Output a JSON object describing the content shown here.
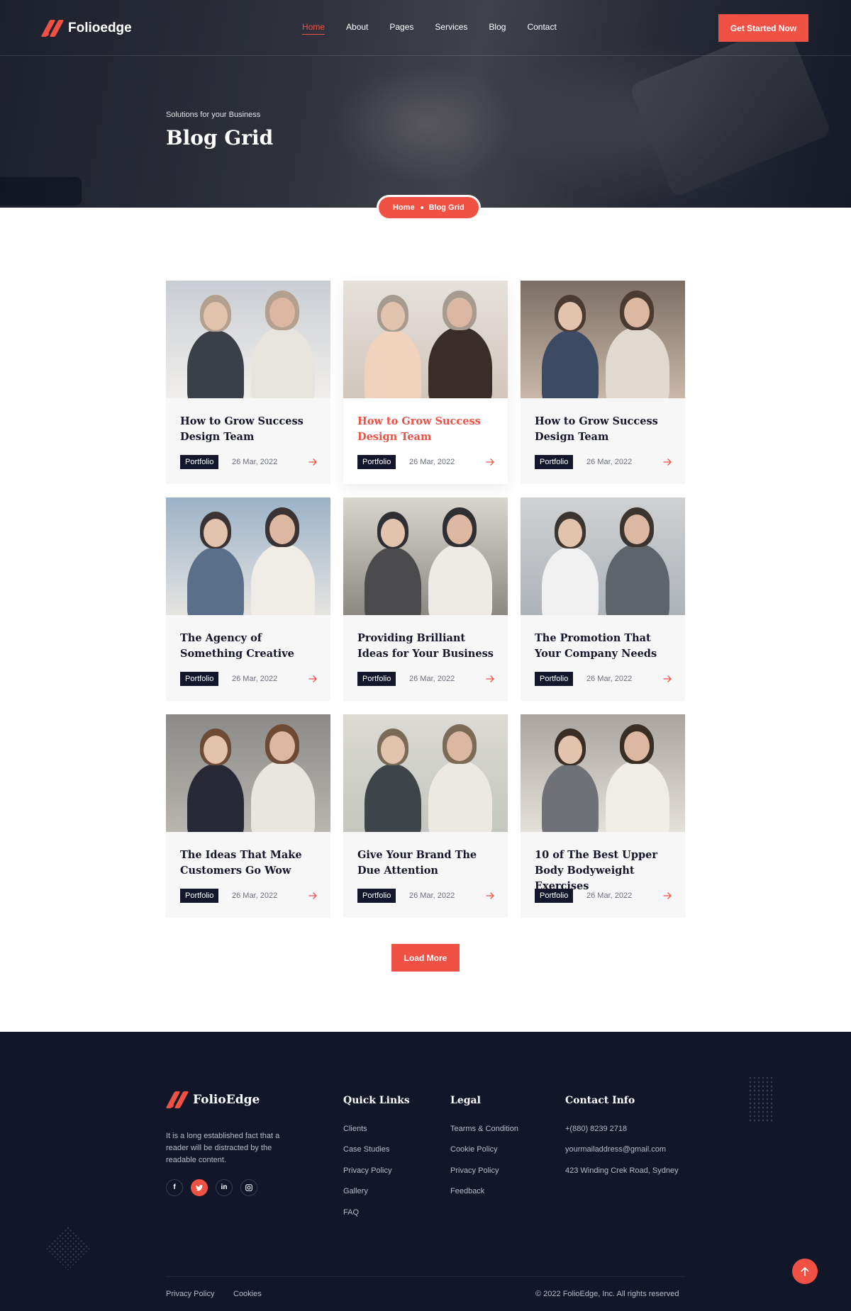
{
  "header": {
    "brand": "Folioedge",
    "nav": [
      "Home",
      "About",
      "Pages",
      "Services",
      "Blog",
      "Contact"
    ],
    "active_nav": "Home",
    "cta": "Get Started Now"
  },
  "hero": {
    "subtitle": "Solutions for your Business",
    "title": "Blog Grid",
    "breadcrumb": {
      "home": "Home",
      "current": "Blog Grid"
    }
  },
  "posts": [
    {
      "title": "How to Grow Success Design Team",
      "tag": "Portfolio",
      "date": "26 Mar, 2022"
    },
    {
      "title": "How to Grow Success Design Team",
      "tag": "Portfolio",
      "date": "26 Mar, 2022",
      "featured": true
    },
    {
      "title": "How to Grow Success Design Team",
      "tag": "Portfolio",
      "date": "26 Mar, 2022"
    },
    {
      "title": "The Agency of Something Creative",
      "tag": "Portfolio",
      "date": "26 Mar, 2022"
    },
    {
      "title": "Providing Brilliant Ideas for Your Business",
      "tag": "Portfolio",
      "date": "26 Mar, 2022"
    },
    {
      "title": "The Promotion That Your Company Needs",
      "tag": "Portfolio",
      "date": "26 Mar, 2022"
    },
    {
      "title": "The Ideas That Make Customers Go Wow",
      "tag": "Portfolio",
      "date": "26 Mar, 2022"
    },
    {
      "title": "Give Your Brand The Due Attention",
      "tag": "Portfolio",
      "date": "26 Mar, 2022"
    },
    {
      "title": "10 of The Best Upper Body Bodyweight Exercises",
      "tag": "Portfolio",
      "date": "26 Mar, 2022"
    }
  ],
  "load_more": "Load More",
  "footer": {
    "brand": "FolioEdge",
    "about": "It is a long established fact that a reader will be distracted by the readable content.",
    "socials": [
      "f",
      "t",
      "in",
      "ig"
    ],
    "quick_links": {
      "title": "Quick Links",
      "items": [
        "Clients",
        "Case Studies",
        "Privacy Policy",
        "Gallery",
        "FAQ"
      ]
    },
    "legal": {
      "title": "Legal",
      "items": [
        "Tearms & Condition",
        "Cookie Policy",
        "Privacy Policy",
        "Feedback"
      ]
    },
    "contact": {
      "title": "Contact Info",
      "items": [
        "+(880) 8239 2718",
        "yourmailaddress@gmail.com",
        "423 Winding Crek Road, Sydney"
      ]
    },
    "bottom_links": [
      "Privacy Policy",
      "Cookies"
    ],
    "copyright": "© 2022 FolioEdge, Inc. All rights reserved"
  },
  "colors": {
    "accent": "#f05145",
    "dark": "#14172b",
    "footer_bg": "#121629"
  },
  "icons": {
    "arrow": "arrow-right-icon",
    "to_top": "arrow-up-icon"
  }
}
